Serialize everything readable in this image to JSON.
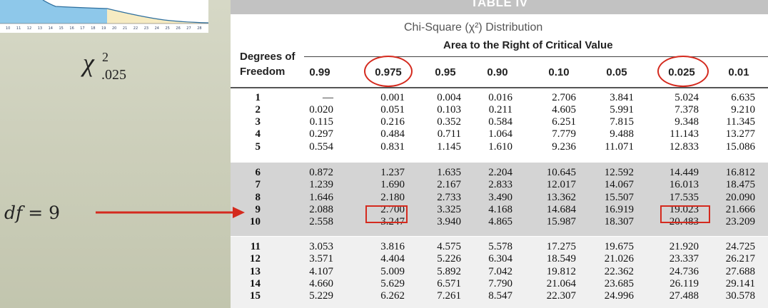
{
  "left": {
    "axis_ticks": [
      "10",
      "11",
      "12",
      "13",
      "14",
      "15",
      "16",
      "17",
      "18",
      "19",
      "20",
      "21",
      "22",
      "23",
      "24",
      "25",
      "26",
      "27",
      "28"
    ],
    "chi_symbol": "χ",
    "chi_superscript": "2",
    "chi_subscript": ".025",
    "df_text": "df = ",
    "df_value": "9"
  },
  "table": {
    "title": "TABLE IV",
    "distribution_title": "Chi-Square (χ²) Distribution",
    "area_title": "Area to the Right of Critical Value",
    "df_header_line1": "Degrees of",
    "df_header_line2": "Freedom",
    "columns": [
      "0.99",
      "0.975",
      "0.95",
      "0.90",
      "0.10",
      "0.05",
      "0.025",
      "0.01"
    ],
    "rows": [
      {
        "df": "1",
        "values": [
          "—",
          "0.001",
          "0.004",
          "0.016",
          "2.706",
          "3.841",
          "5.024",
          "6.635"
        ]
      },
      {
        "df": "2",
        "values": [
          "0.020",
          "0.051",
          "0.103",
          "0.211",
          "4.605",
          "5.991",
          "7.378",
          "9.210"
        ]
      },
      {
        "df": "3",
        "values": [
          "0.115",
          "0.216",
          "0.352",
          "0.584",
          "6.251",
          "7.815",
          "9.348",
          "11.345"
        ]
      },
      {
        "df": "4",
        "values": [
          "0.297",
          "0.484",
          "0.711",
          "1.064",
          "7.779",
          "9.488",
          "11.143",
          "13.277"
        ]
      },
      {
        "df": "5",
        "values": [
          "0.554",
          "0.831",
          "1.145",
          "1.610",
          "9.236",
          "11.071",
          "12.833",
          "15.086"
        ]
      },
      {
        "df": "6",
        "values": [
          "0.872",
          "1.237",
          "1.635",
          "2.204",
          "10.645",
          "12.592",
          "14.449",
          "16.812"
        ]
      },
      {
        "df": "7",
        "values": [
          "1.239",
          "1.690",
          "2.167",
          "2.833",
          "12.017",
          "14.067",
          "16.013",
          "18.475"
        ]
      },
      {
        "df": "8",
        "values": [
          "1.646",
          "2.180",
          "2.733",
          "3.490",
          "13.362",
          "15.507",
          "17.535",
          "20.090"
        ]
      },
      {
        "df": "9",
        "values": [
          "2.088",
          "2.700",
          "3.325",
          "4.168",
          "14.684",
          "16.919",
          "19.023",
          "21.666"
        ]
      },
      {
        "df": "10",
        "values": [
          "2.558",
          "3.247",
          "3.940",
          "4.865",
          "15.987",
          "18.307",
          "20.483",
          "23.209"
        ]
      },
      {
        "df": "11",
        "values": [
          "3.053",
          "3.816",
          "4.575",
          "5.578",
          "17.275",
          "19.675",
          "21.920",
          "24.725"
        ]
      },
      {
        "df": "12",
        "values": [
          "3.571",
          "4.404",
          "5.226",
          "6.304",
          "18.549",
          "21.026",
          "23.337",
          "26.217"
        ]
      },
      {
        "df": "13",
        "values": [
          "4.107",
          "5.009",
          "5.892",
          "7.042",
          "19.812",
          "22.362",
          "24.736",
          "27.688"
        ]
      },
      {
        "df": "14",
        "values": [
          "4.660",
          "5.629",
          "6.571",
          "7.790",
          "21.064",
          "23.685",
          "26.119",
          "29.141"
        ]
      },
      {
        "df": "15",
        "values": [
          "5.229",
          "6.262",
          "7.261",
          "8.547",
          "22.307",
          "24.996",
          "27.488",
          "30.578"
        ]
      }
    ],
    "highlighted_columns": [
      "0.975",
      "0.025"
    ],
    "highlighted_row": "9",
    "highlighted_values": [
      "2.700",
      "19.023"
    ]
  },
  "colors": {
    "annotation_red": "#d42a1e",
    "curve_fill": "#8ec8ea",
    "tail_fill": "#f6ebc2"
  }
}
